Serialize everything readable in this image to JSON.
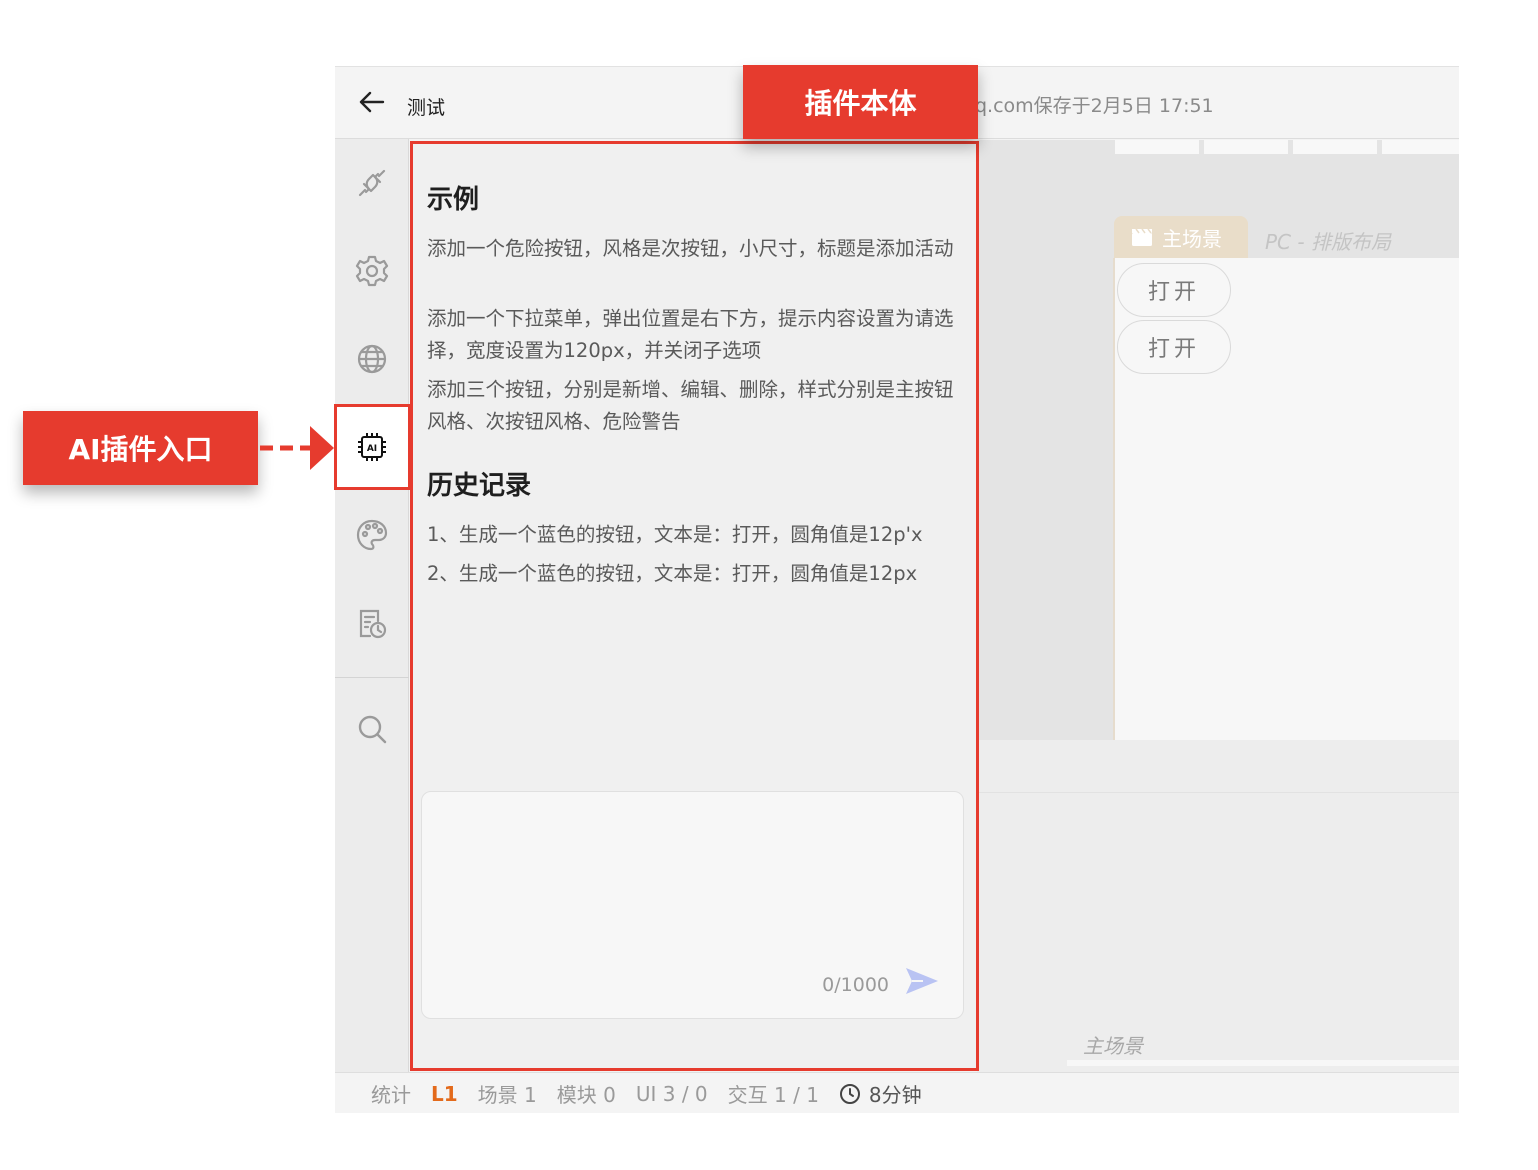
{
  "window": {
    "project_title": "测试",
    "save_status": "q.com保存于2月5日 17:51"
  },
  "rail": {
    "items": [
      {
        "name": "plugin-icon"
      },
      {
        "name": "gear-icon"
      },
      {
        "name": "globe-icon"
      },
      {
        "name": "ai-chip-icon",
        "active": true
      },
      {
        "name": "palette-icon"
      },
      {
        "name": "document-history-icon"
      },
      {
        "name": "search-icon"
      }
    ]
  },
  "plugin_panel": {
    "examples_title": "示例",
    "examples": [
      "添加一个危险按钮，风格是次按钮，小尺寸，标题是添加活动",
      "添加一个下拉菜单，弹出位置是右下方，提示内容设置为请选择，宽度设置为120px，并关闭子选项",
      "添加三个按钮，分别是新增、编辑、删除，样式分别是主按钮风格、次按钮风格、危险警告"
    ],
    "history_title": "历史记录",
    "history": [
      "1、生成一个蓝色的按钮，文本是：打开，圆角值是12p'x",
      "2、生成一个蓝色的按钮，文本是：打开，圆角值是12px"
    ],
    "input": {
      "placeholder": "",
      "counter": "0/1000"
    }
  },
  "canvas": {
    "scene_tab": "主场景",
    "layout_label": "PC - 排版布局",
    "buttons": [
      "打开",
      "打开"
    ],
    "footer_scene_label": "主场景"
  },
  "statusbar": {
    "stats_label": "统计",
    "level": "L1",
    "scene": "场景 1",
    "module": "模块 0",
    "ui": "UI 3 / 0",
    "interaction": "交互 1 / 1",
    "time": "8分钟"
  },
  "annotations": {
    "plugin_body": "插件本体",
    "ai_entry": "AI插件入口"
  },
  "colors": {
    "annotation_red": "#e63b2e",
    "level_orange": "#e36a1b",
    "send_blue": "#b9c3f3",
    "scene_tab_beige": "#e9ddc9"
  }
}
